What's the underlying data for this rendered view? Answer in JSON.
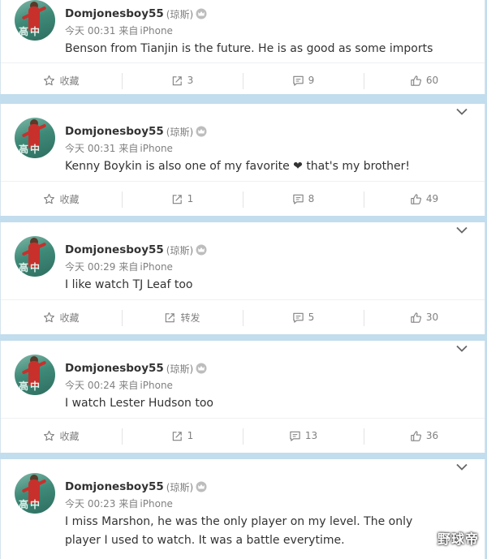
{
  "icons": {
    "collect": "star-icon",
    "repost": "share-arrow-icon",
    "comment": "comment-bubble-icon",
    "like": "thumbs-up-icon",
    "menu": "chevron-down-icon",
    "vip": "crown-icon"
  },
  "colors": {
    "page_background": "#c2dded",
    "card": "#ffffff",
    "meta_text": "#808080",
    "name_text": "#333333"
  },
  "avatar_text": "高中",
  "posts": [
    {
      "author": "Domjonesboy55",
      "remark": "(琼斯)",
      "time": "今天 00:31",
      "source_prefix": "来自",
      "source": "iPhone",
      "text": "Benson from Tianjin is the future. He is as good as some imports",
      "collect_label": "收藏",
      "repost": "3",
      "comments": "9",
      "likes": "60"
    },
    {
      "author": "Domjonesboy55",
      "remark": "(琼斯)",
      "time": "今天 00:31",
      "source_prefix": "来自",
      "source": "iPhone",
      "text": "Kenny Boykin is also one of my favorite ❤ that's my brother!",
      "collect_label": "收藏",
      "repost": "1",
      "comments": "8",
      "likes": "49"
    },
    {
      "author": "Domjonesboy55",
      "remark": "(琼斯)",
      "time": "今天 00:29",
      "source_prefix": "来自",
      "source": "iPhone",
      "text": "I like watch TJ Leaf too",
      "collect_label": "收藏",
      "repost": "转发",
      "comments": "5",
      "likes": "30"
    },
    {
      "author": "Domjonesboy55",
      "remark": "(琼斯)",
      "time": "今天 00:24",
      "source_prefix": "来自",
      "source": "iPhone",
      "text": "I watch Lester Hudson too",
      "collect_label": "收藏",
      "repost": "1",
      "comments": "13",
      "likes": "36"
    },
    {
      "author": "Domjonesboy55",
      "remark": "(琼斯)",
      "time": "今天 00:23",
      "source_prefix": "来自",
      "source": "iPhone",
      "text": "I miss Marshon, he was the only player on my level. The only player I used to watch. It was a battle everytime."
    }
  ],
  "watermark": "野球帝"
}
